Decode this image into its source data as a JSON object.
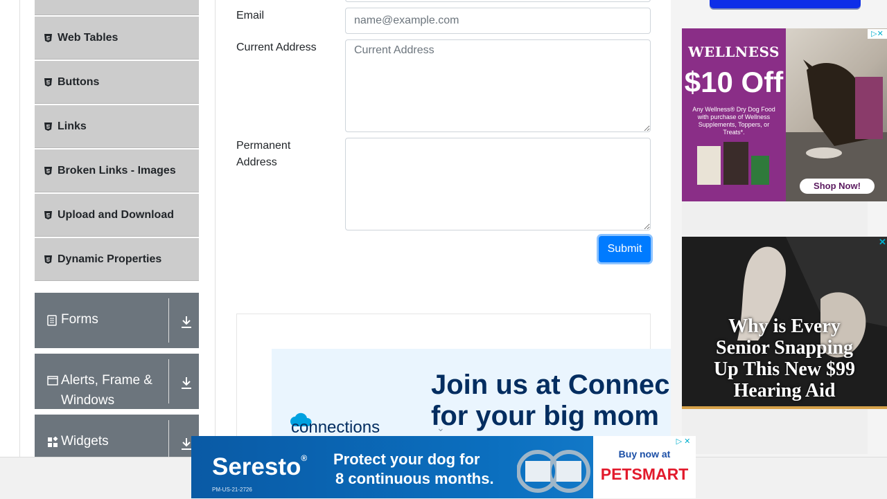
{
  "sidebar": {
    "elements_items": [
      {
        "label": ""
      },
      {
        "label": "Web Tables"
      },
      {
        "label": "Buttons"
      },
      {
        "label": "Links"
      },
      {
        "label": "Broken Links - Images"
      },
      {
        "label": "Upload and Download"
      },
      {
        "label": "Dynamic Properties"
      }
    ],
    "groups": [
      {
        "label": "Forms",
        "icon": "form-icon"
      },
      {
        "label": "Alerts, Frame &",
        "label2": "Windows",
        "icon": "window-icon"
      },
      {
        "label": "Widgets",
        "icon": "widgets-icon"
      }
    ]
  },
  "form": {
    "email_label": "Email",
    "email_placeholder": "name@example.com",
    "current_address_label": "Current Address",
    "current_address_placeholder": "Current Address",
    "permanent_address_label": "Permanent",
    "permanent_address_label2": "Address",
    "submit_label": "Submit"
  },
  "ads": {
    "connections": {
      "headline1": "Join us at Connec",
      "headline2": "for your big mom",
      "brand": "connections"
    },
    "wellness": {
      "brand": "WELLNESS",
      "offer": "$10 Off",
      "fine1": "Any Wellness® Dry Dog Food",
      "fine2": "with purchase of Wellness",
      "fine3": "Supplements, Toppers, or Treats*.",
      "cta": "Shop Now!"
    },
    "hearing": {
      "line1": "Why is Every",
      "line2": "Senior Snapping",
      "line3": "Up This New $99",
      "line4": "Hearing Aid"
    },
    "seresto": {
      "brand": "Seresto",
      "reg": "®",
      "code": "PM-US-21-2726",
      "tag1": "Protect your dog for",
      "tag2": "8 continuous months.",
      "buy": "Buy now at",
      "store": "PETSMART"
    }
  },
  "colors": {
    "primary": "#007bff",
    "group_bg": "#6c757d",
    "menu_bg": "#cccccc"
  }
}
